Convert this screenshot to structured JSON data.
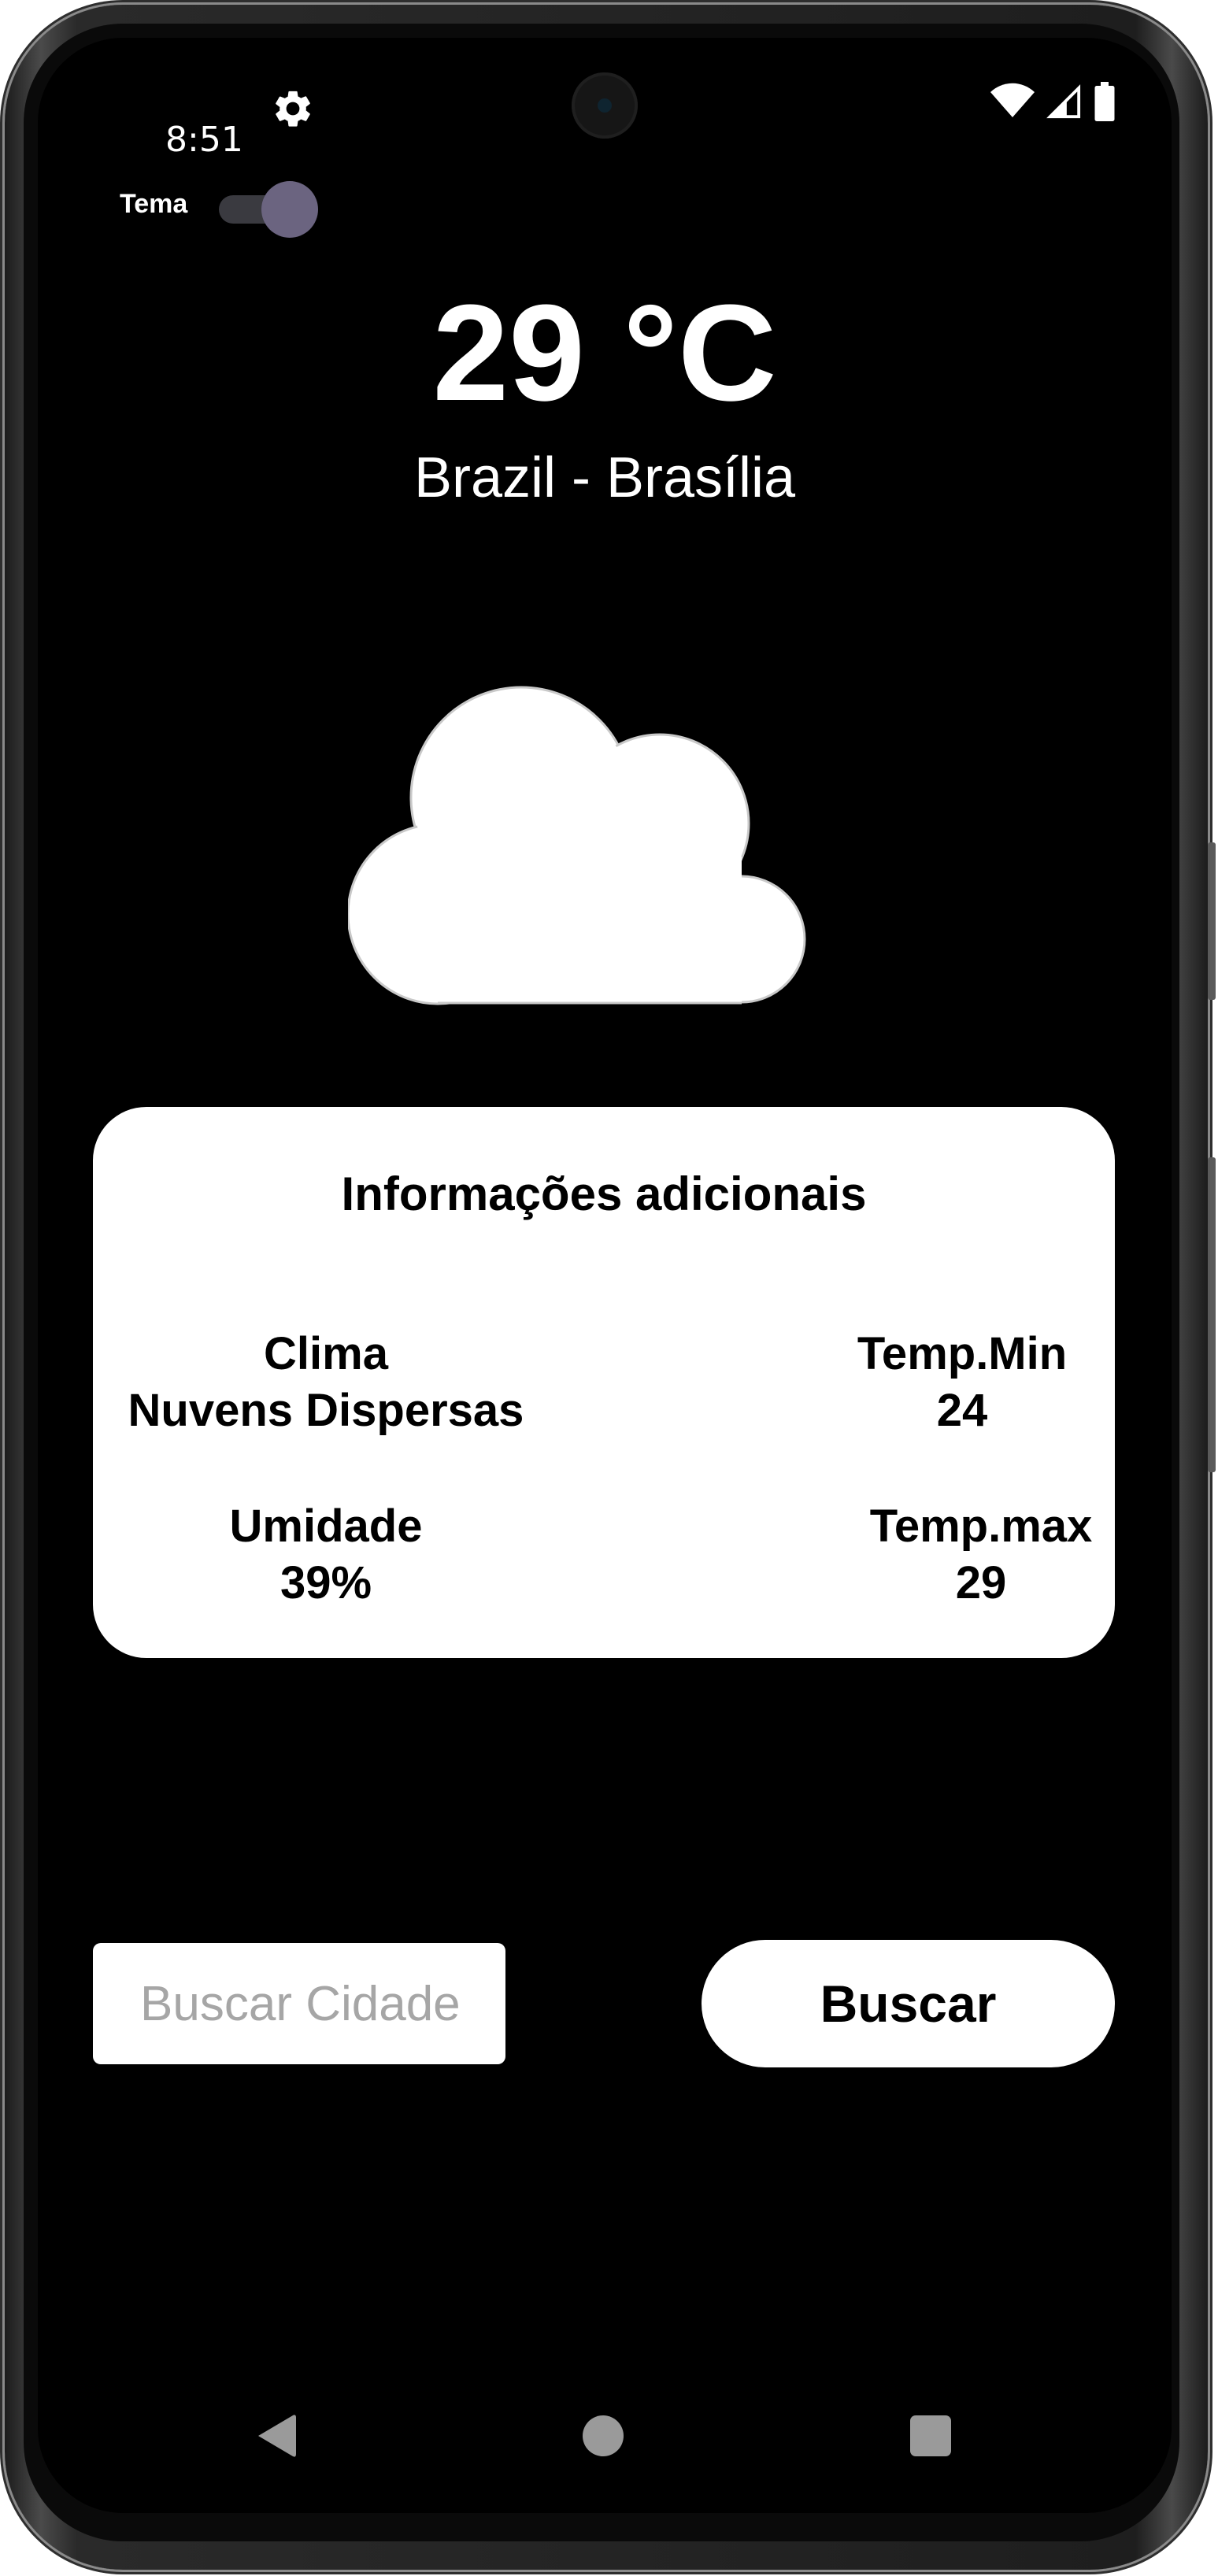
{
  "status_bar": {
    "time": "8:51",
    "icons": [
      "settings-icon",
      "wifi-icon",
      "cellular-signal-icon",
      "battery-icon"
    ]
  },
  "theme_toggle": {
    "label": "Tema",
    "enabled": true
  },
  "weather": {
    "temperature": "29 °C",
    "location": "Brazil - Brasília",
    "icon": "cloud-icon"
  },
  "info_card": {
    "title": "Informações adicionais",
    "clima_label": "Clima",
    "clima_value": "Nuvens Dispersas",
    "temp_min_label": "Temp.Min",
    "temp_min_value": "24",
    "umidade_label": "Umidade",
    "umidade_value": "39%",
    "temp_max_label": "Temp.max",
    "temp_max_value": "29"
  },
  "search": {
    "placeholder": "Buscar Cidade",
    "value": "",
    "button_label": "Buscar"
  },
  "nav_bar": {
    "icons": [
      "back-icon",
      "home-icon",
      "recents-icon"
    ]
  },
  "colors": {
    "background": "#000000",
    "card": "#ffffff",
    "toggle_thumb": "#6b6480",
    "placeholder": "#a6a6a6"
  }
}
